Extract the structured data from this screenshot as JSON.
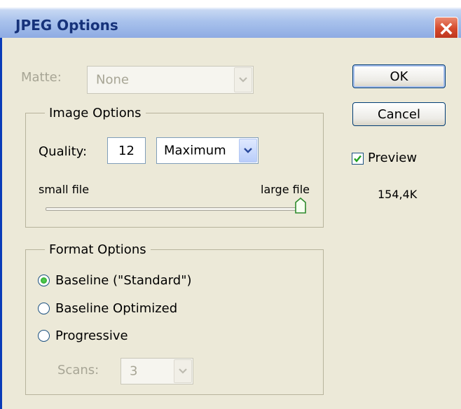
{
  "window": {
    "title": "JPEG Options",
    "close_icon": "close-icon"
  },
  "matte": {
    "label": "Matte:",
    "value": "None"
  },
  "image_options": {
    "legend": "Image Options",
    "quality_label": "Quality:",
    "quality_value": "12",
    "quality_preset": "Maximum",
    "small_label": "small file",
    "large_label": "large file",
    "slider_level": 1.0
  },
  "format_options": {
    "legend": "Format Options",
    "radios": [
      {
        "label": "Baseline (\"Standard\")",
        "selected": true
      },
      {
        "label": "Baseline Optimized",
        "selected": false
      },
      {
        "label": "Progressive",
        "selected": false
      }
    ],
    "scans_label": "Scans:",
    "scans_value": "3"
  },
  "buttons": {
    "ok": "OK",
    "cancel": "Cancel"
  },
  "preview": {
    "label": "Preview",
    "checked": true,
    "size": "154,4K"
  },
  "colors": {
    "title_text": "#16327a",
    "dialog_bg": "#ece9d8",
    "frame_blue": "#0a3bb8",
    "close_red": "#d5492b"
  }
}
